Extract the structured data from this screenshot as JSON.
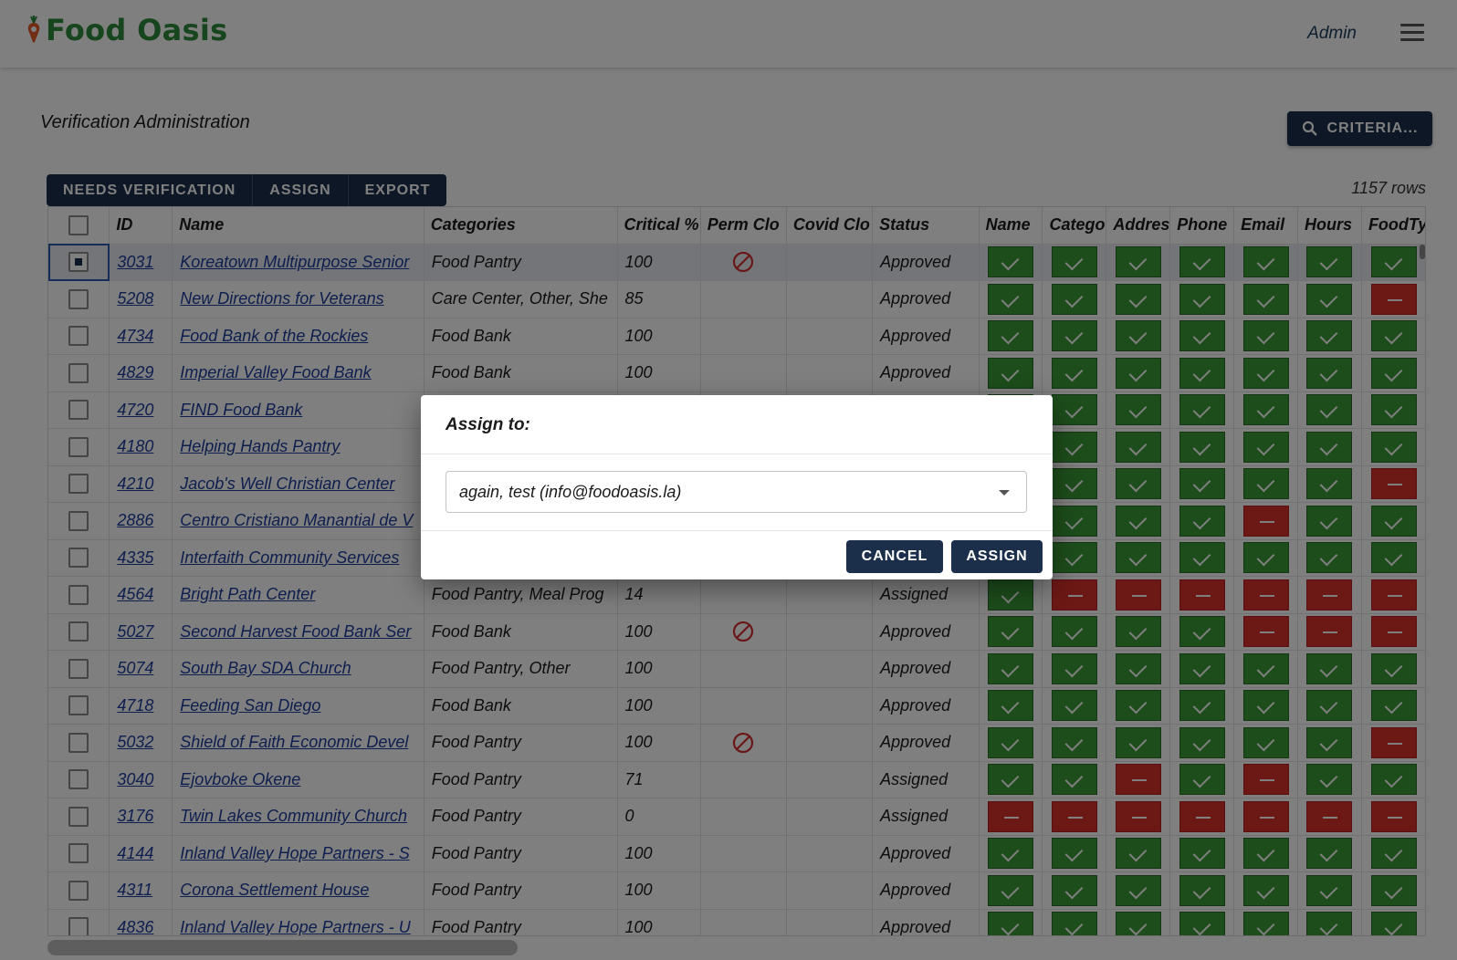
{
  "app": {
    "name": "Food Oasis",
    "user": "Admin"
  },
  "page": {
    "title": "Verification Administration",
    "criteria_label": "CRITERIA...",
    "rows_count": "1157 rows"
  },
  "toolbar": {
    "needs_verification": "NEEDS VERIFICATION",
    "assign": "ASSIGN",
    "export": "EXPORT"
  },
  "table": {
    "columns": [
      "ID",
      "Name",
      "Categories",
      "Critical %",
      "Perm Clo",
      "Covid Clo",
      "Status",
      "Name",
      "Catego",
      "Addres",
      "Phone",
      "Email",
      "Hours",
      "FoodTy"
    ],
    "rows": [
      {
        "id": "3031",
        "name": "Koreatown Multipurpose Senior",
        "categories": "Food Pantry",
        "critical": "100",
        "perm_closed": true,
        "status": "Approved",
        "checks": [
          1,
          1,
          1,
          1,
          1,
          1,
          1
        ],
        "selected": true
      },
      {
        "id": "5208",
        "name": "New Directions for Veterans",
        "categories": "Care Center, Other, She",
        "critical": "85",
        "perm_closed": false,
        "status": "Approved",
        "checks": [
          1,
          1,
          1,
          1,
          1,
          1,
          0
        ]
      },
      {
        "id": "4734",
        "name": "Food Bank of the Rockies",
        "categories": "Food Bank",
        "critical": "100",
        "perm_closed": false,
        "status": "Approved",
        "checks": [
          1,
          1,
          1,
          1,
          1,
          1,
          1
        ]
      },
      {
        "id": "4829",
        "name": "Imperial Valley Food Bank",
        "categories": "Food Bank",
        "critical": "100",
        "perm_closed": false,
        "status": "Approved",
        "checks": [
          1,
          1,
          1,
          1,
          1,
          1,
          1
        ]
      },
      {
        "id": "4720",
        "name": "FIND Food Bank",
        "categories": "",
        "critical": "",
        "perm_closed": false,
        "status": "",
        "checks": [
          1,
          1,
          1,
          1,
          1,
          1,
          1
        ]
      },
      {
        "id": "4180",
        "name": "Helping Hands Pantry",
        "categories": "",
        "critical": "",
        "perm_closed": false,
        "status": "",
        "checks": [
          1,
          1,
          1,
          1,
          1,
          1,
          1
        ]
      },
      {
        "id": "4210",
        "name": "Jacob's Well Christian Center",
        "categories": "",
        "critical": "",
        "perm_closed": false,
        "status": "",
        "checks": [
          1,
          1,
          1,
          1,
          1,
          1,
          0
        ]
      },
      {
        "id": "2886",
        "name": "Centro Cristiano Manantial de V",
        "categories": "",
        "critical": "",
        "perm_closed": false,
        "status": "",
        "checks": [
          1,
          1,
          1,
          1,
          0,
          1,
          1
        ]
      },
      {
        "id": "4335",
        "name": "Interfaith Community Services",
        "categories": "",
        "critical": "",
        "perm_closed": false,
        "status": "",
        "checks": [
          1,
          1,
          1,
          1,
          1,
          1,
          1
        ]
      },
      {
        "id": "4564",
        "name": "Bright Path Center",
        "categories": "Food Pantry, Meal Prog",
        "critical": "14",
        "perm_closed": false,
        "status": "Assigned",
        "checks": [
          1,
          0,
          0,
          0,
          0,
          0,
          0
        ]
      },
      {
        "id": "5027",
        "name": "Second Harvest Food Bank Ser",
        "categories": "Food Bank",
        "critical": "100",
        "perm_closed": true,
        "status": "Approved",
        "checks": [
          1,
          1,
          1,
          1,
          0,
          0,
          0
        ]
      },
      {
        "id": "5074",
        "name": "South Bay SDA Church",
        "categories": "Food Pantry, Other",
        "critical": "100",
        "perm_closed": false,
        "status": "Approved",
        "checks": [
          1,
          1,
          1,
          1,
          1,
          1,
          1
        ]
      },
      {
        "id": "4718",
        "name": "Feeding San Diego",
        "categories": "Food Bank",
        "critical": "100",
        "perm_closed": false,
        "status": "Approved",
        "checks": [
          1,
          1,
          1,
          1,
          1,
          1,
          1
        ]
      },
      {
        "id": "5032",
        "name": "Shield of Faith Economic Devel",
        "categories": "Food Pantry",
        "critical": "100",
        "perm_closed": true,
        "status": "Approved",
        "checks": [
          1,
          1,
          1,
          1,
          1,
          1,
          0
        ]
      },
      {
        "id": "3040",
        "name": "Ejovboke Okene",
        "categories": "Food Pantry",
        "critical": "71",
        "perm_closed": false,
        "status": "Assigned",
        "checks": [
          1,
          1,
          0,
          1,
          0,
          1,
          1
        ]
      },
      {
        "id": "3176",
        "name": "Twin Lakes Community Church",
        "categories": "Food Pantry",
        "critical": "0",
        "perm_closed": false,
        "status": "Assigned",
        "checks": [
          0,
          0,
          0,
          0,
          0,
          0,
          0
        ]
      },
      {
        "id": "4144",
        "name": "Inland Valley Hope Partners - S",
        "categories": "Food Pantry",
        "critical": "100",
        "perm_closed": false,
        "status": "Approved",
        "checks": [
          1,
          1,
          1,
          1,
          1,
          1,
          1
        ]
      },
      {
        "id": "4311",
        "name": "Corona Settlement House",
        "categories": "Food Pantry",
        "critical": "100",
        "perm_closed": false,
        "status": "Approved",
        "checks": [
          1,
          1,
          1,
          1,
          1,
          1,
          1
        ]
      },
      {
        "id": "4836",
        "name": "Inland Valley Hope Partners - U",
        "categories": "Food Pantry",
        "critical": "100",
        "perm_closed": false,
        "status": "Approved",
        "checks": [
          1,
          1,
          1,
          1,
          1,
          1,
          1
        ]
      }
    ]
  },
  "dialog": {
    "title": "Assign to:",
    "selected_user": "again, test (info@foodoasis.la)",
    "cancel": "CANCEL",
    "assign": "ASSIGN"
  },
  "colors": {
    "brand_green": "#2f8a3b",
    "navy": "#1b2f4b",
    "ok_green": "#3a9a37",
    "bad_red": "#d9312a",
    "link": "#1c3c9c"
  }
}
